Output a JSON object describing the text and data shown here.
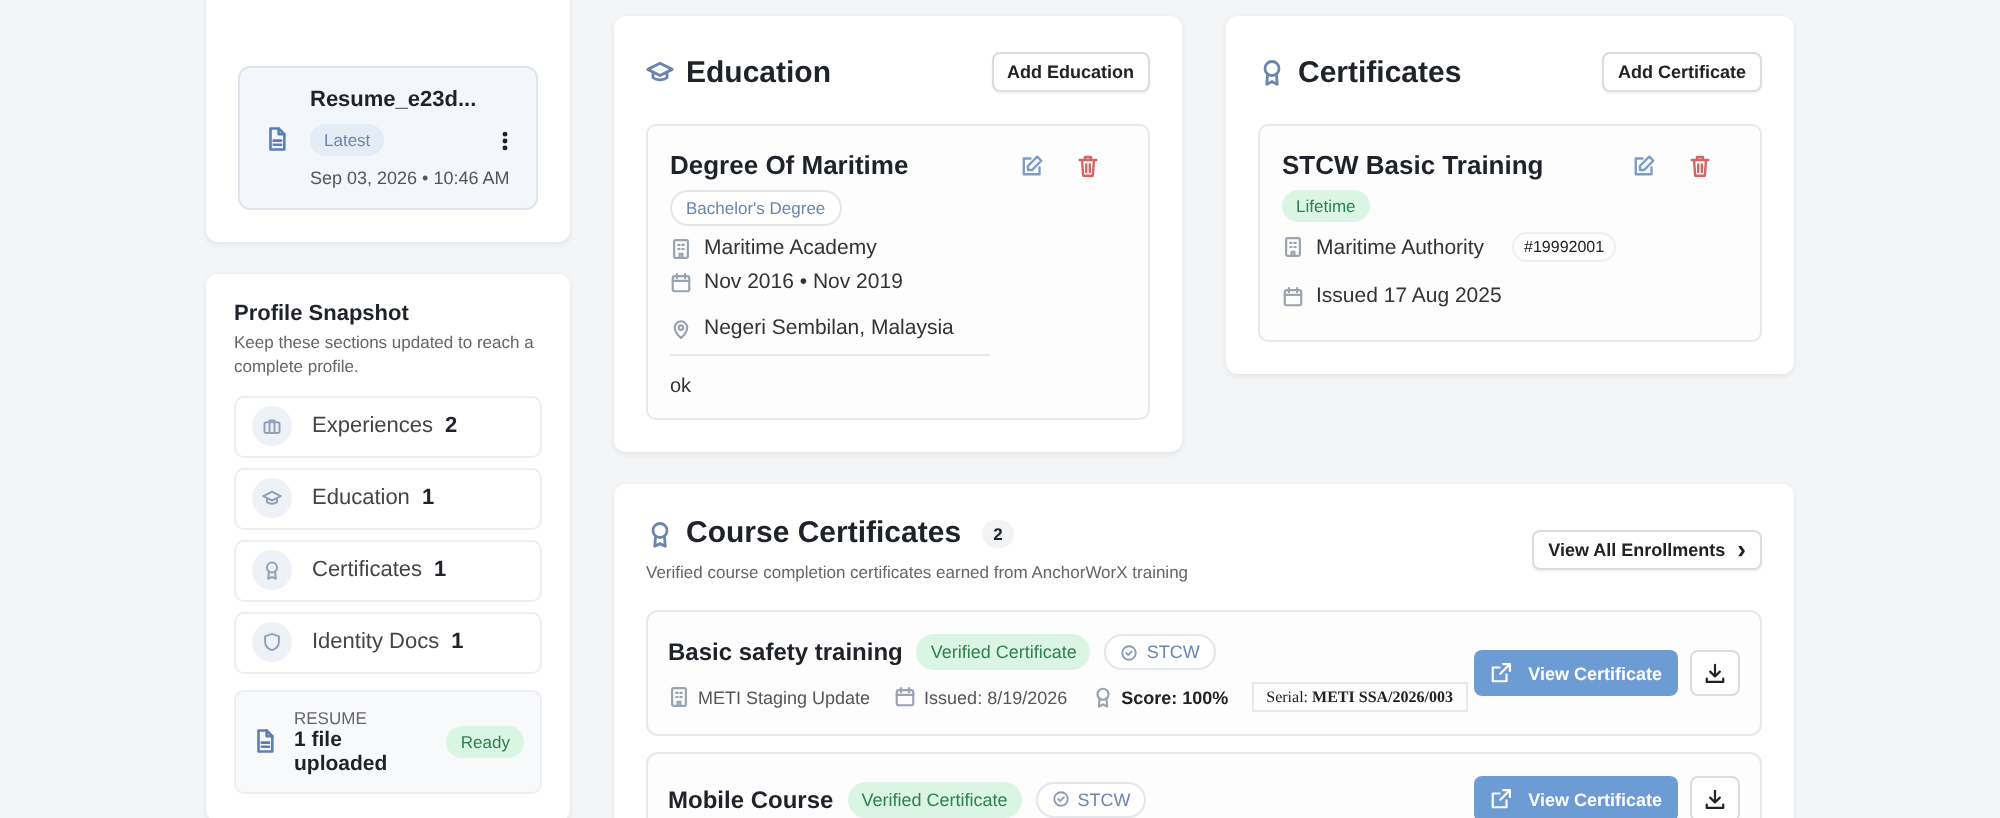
{
  "resume_card": {
    "file_name": "Resume_e23d...",
    "badge": "Latest",
    "date": "Sep 03, 2026 • 10:46 AM"
  },
  "profile_snapshot": {
    "title": "Profile Snapshot",
    "subtitle": "Keep these sections updated to reach a complete profile.",
    "items": [
      {
        "kind": "briefcase",
        "label": "Experiences",
        "count": "2"
      },
      {
        "kind": "cap",
        "label": "Education",
        "count": "1"
      },
      {
        "kind": "award",
        "label": "Certificates",
        "count": "1"
      },
      {
        "kind": "shield",
        "label": "Identity Docs",
        "count": "1"
      }
    ],
    "resume": {
      "label": "RESUME",
      "value": "1 file uploaded",
      "status": "Ready"
    }
  },
  "education": {
    "title": "Education",
    "add_button": "Add Education",
    "entries": [
      {
        "title": "Degree Of Maritime",
        "degree": "Bachelor's Degree",
        "school": "Maritime Academy",
        "dates": "Nov 2016 • Nov 2019",
        "location": "Negeri Sembilan, Malaysia",
        "note": "ok"
      }
    ]
  },
  "certificates": {
    "title": "Certificates",
    "add_button": "Add Certificate",
    "entries": [
      {
        "title": "STCW Basic Training",
        "validity": "Lifetime",
        "issuer": "Maritime Authority",
        "number": "#19992001",
        "issued": "Issued 17 Aug 2025"
      }
    ]
  },
  "course_certificates": {
    "title": "Course Certificates",
    "count": "2",
    "subtitle": "Verified course completion certificates earned from AnchorWorX training",
    "view_all": "View All Enrollments",
    "view_all_icon": "›",
    "items": [
      {
        "title": "Basic safety training",
        "status": "Verified Certificate",
        "tag": "STCW",
        "provider": "METI Staging Update",
        "issued": "Issued: 8/19/2026",
        "score": "Score: 100%",
        "serial": "Serial: **METI SSA/2026/003**",
        "view_button": "View Certificate"
      },
      {
        "title": "Mobile Course",
        "status": "Verified Certificate",
        "tag": "STCW",
        "view_button": "View Certificate"
      }
    ]
  }
}
